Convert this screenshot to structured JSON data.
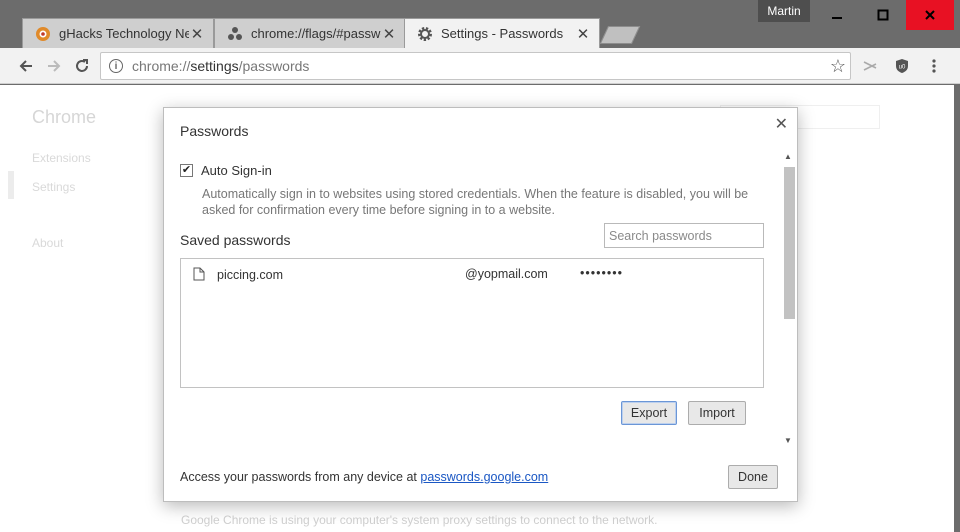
{
  "window": {
    "profile_name": "Martin",
    "controls": {
      "minimize_icon": "minimize-icon",
      "maximize_icon": "maximize-icon",
      "close_icon": "close-icon"
    }
  },
  "tabs": [
    {
      "title": "gHacks Technology New:",
      "icon": "ghacks-favicon",
      "active": false
    },
    {
      "title": "chrome://flags/#passwo",
      "icon": "flags-favicon",
      "active": false
    },
    {
      "title": "Settings - Passwords",
      "icon": "gear-icon",
      "active": true
    }
  ],
  "toolbar": {
    "url_scheme": "chrome://",
    "url_host": "settings",
    "url_path": "/passwords",
    "icons": [
      "back-icon",
      "forward-icon",
      "reload-icon",
      "info-icon",
      "star-icon",
      "extension-scissors-icon",
      "ublock-shield-icon",
      "menu-icon"
    ]
  },
  "background_page": {
    "title": "Chrome",
    "nav": [
      "Extensions",
      "Settings",
      "About"
    ],
    "footer": "Google Chrome is using your computer's system proxy settings to connect to the network."
  },
  "dialog": {
    "title": "Passwords",
    "auto_signin": {
      "label": "Auto Sign-in",
      "checked": true,
      "description": "Automatically sign in to websites using stored credentials. When the feature is disabled, you will be asked for confirmation every time before signing in to a website."
    },
    "saved_heading": "Saved passwords",
    "search_placeholder": "Search passwords",
    "entries": [
      {
        "site": "piccing.com",
        "username": "@yopmail.com",
        "password": "••••••••"
      }
    ],
    "export_label": "Export",
    "import_label": "Import",
    "footer_prefix": "Access your passwords from any device at ",
    "footer_link": "passwords.google.com",
    "done_label": "Done"
  },
  "colors": {
    "frame": "#6c6c6c",
    "close_button": "#e81123",
    "link": "#1a57c4",
    "focus_border": "#6b96d6"
  }
}
